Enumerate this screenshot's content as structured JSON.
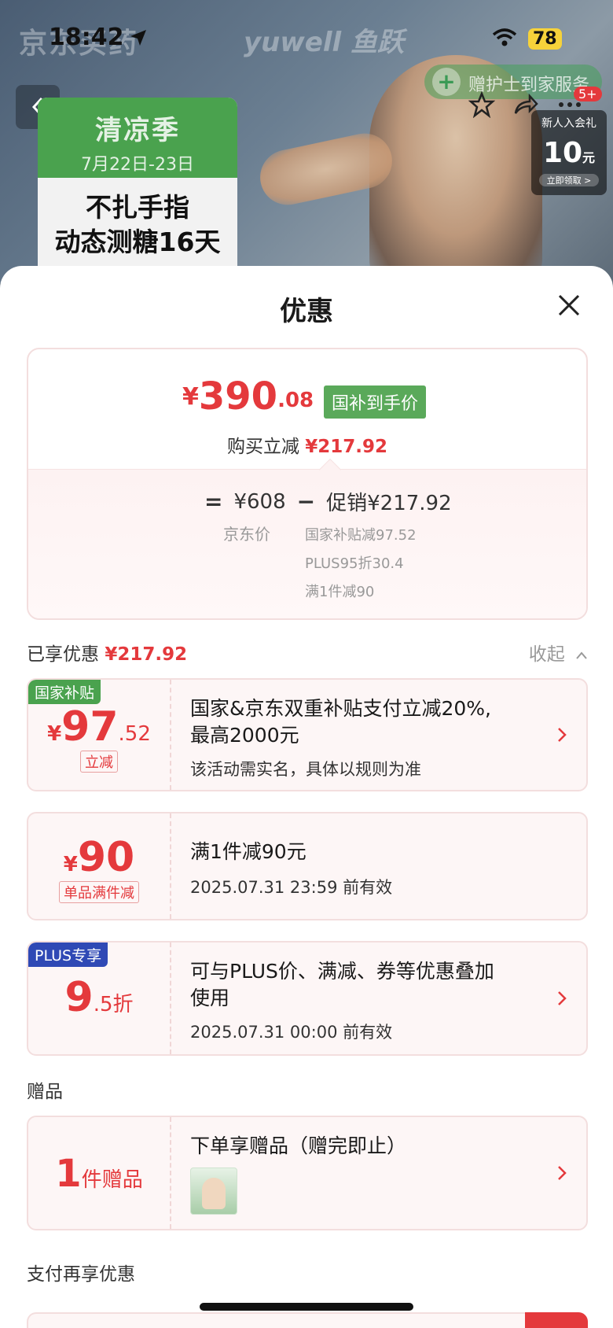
{
  "status_bar": {
    "time": "18:42",
    "battery": "78"
  },
  "background": {
    "brand1": "京东买药",
    "brand2": "yuwell 鱼跃",
    "nurse_banner": "赠护士到家服务",
    "badge": "5+",
    "new_member": {
      "title": "新人入会礼",
      "amount": "10",
      "unit": "元",
      "cta": "立即领取 >"
    },
    "season": {
      "title": "清凉季",
      "date": "7月22日-23日",
      "line1": "不扎手指",
      "line2": "动态测糖16天"
    }
  },
  "sheet": {
    "title": "优惠",
    "price_card": {
      "currency": "¥",
      "price_int": "390",
      "price_dec": ".08",
      "tag": "国补到手价",
      "sub_label": "购买立减",
      "sub_value": "¥217.92",
      "equation": {
        "eq": "=",
        "jd_price": "¥608",
        "minus": "−",
        "promo": "促销¥217.92"
      },
      "jd_label": "京东价",
      "promo_lines": [
        "国家补贴减97.52",
        "PLUS95折30.4",
        "满1件减90"
      ]
    },
    "enjoyed": {
      "label": "已享优惠",
      "value": "¥217.92",
      "collapse": "收起"
    },
    "coupons": [
      {
        "tag": "国家补贴",
        "currency": "¥",
        "amount": "97",
        "amount_dec": ".52",
        "sub": "立减",
        "title_l1": "国家&京东双重补贴支付立减20%,",
        "title_l2": "最高2000元",
        "desc": "该活动需实名，具体以规则为准"
      },
      {
        "currency": "¥",
        "amount": "90",
        "sub": "单品满件减",
        "title_l1": "满1件减90元",
        "desc": "2025.07.31 23:59 前有效"
      },
      {
        "tag": "PLUS专享",
        "amount": "9",
        "amount_dec": ".5折",
        "title_l1": "可与PLUS价、满减、券等优惠叠加",
        "title_l2": "使用",
        "desc": "2025.07.31 00:00 前有效"
      }
    ],
    "gift_section": {
      "label": "赠品",
      "count": "1",
      "count_unit": "件赠品",
      "title": "下单享赠品（赠完即止）"
    },
    "pay_section": {
      "label": "支付再享优惠"
    }
  }
}
